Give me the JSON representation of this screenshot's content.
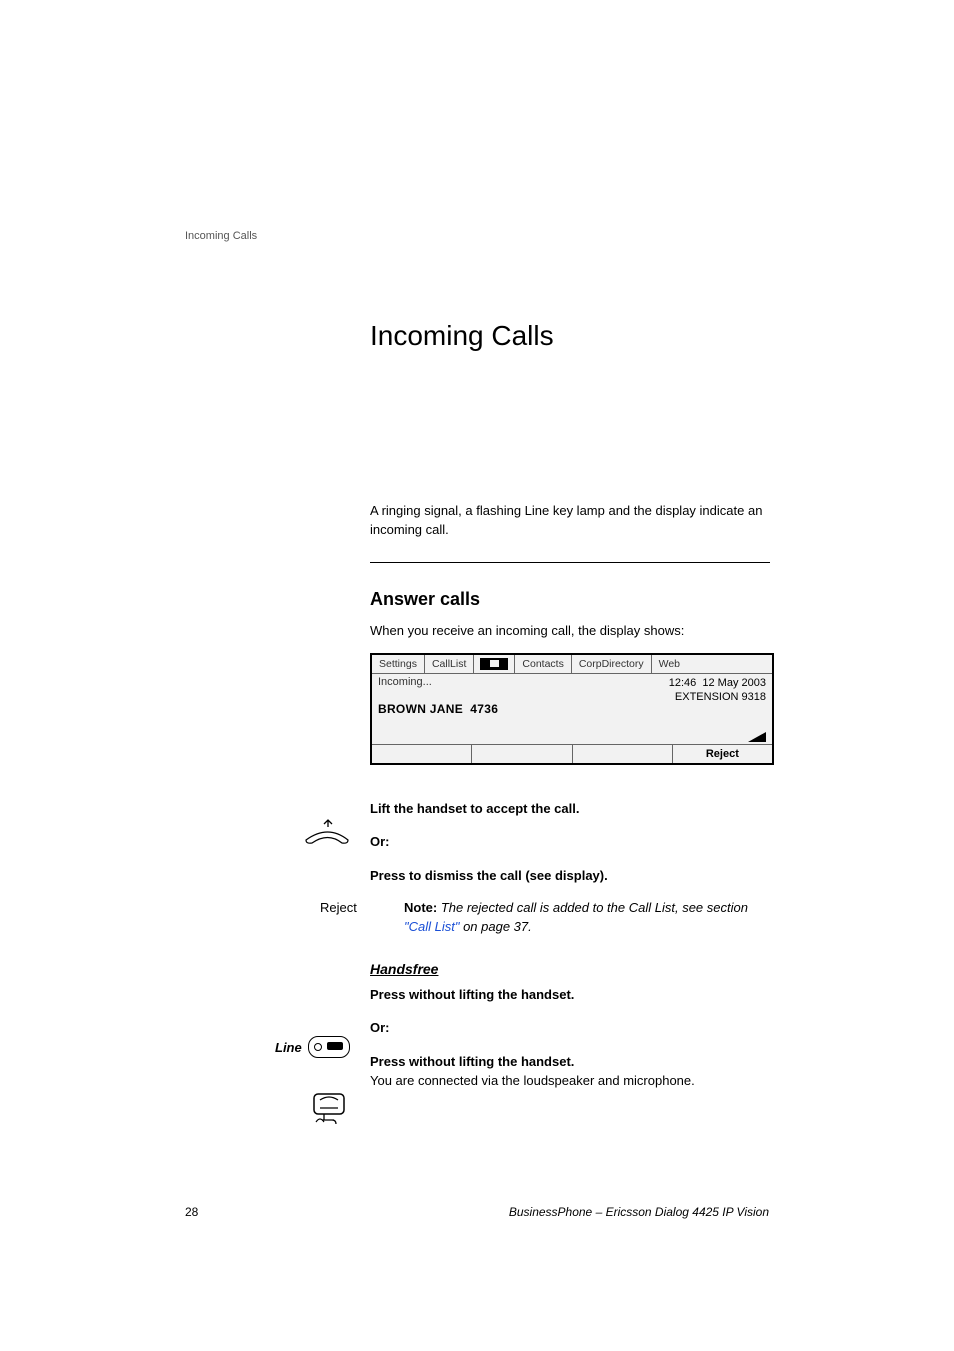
{
  "header_label": "Incoming Calls",
  "title": "Incoming Calls",
  "intro": "A ringing signal, a flashing Line key lamp and the display indicate an incoming call.",
  "section_heading": "Answer calls",
  "display_intro": "When you receive an incoming call, the display shows:",
  "display": {
    "menu": [
      "Settings",
      "CallList",
      "Contacts",
      "CorpDirectory",
      "Web"
    ],
    "status": "Incoming...",
    "time": "12:46",
    "date": "12 May 2003",
    "extension": "EXTENSION 9318",
    "caller_name": "BROWN JANE",
    "caller_number": "4736",
    "softkeys": [
      "",
      "",
      "",
      "Reject"
    ]
  },
  "instr": {
    "lift": "Lift the handset to accept the call.",
    "or": "Or:",
    "reject_label": "Reject",
    "reject_text": "Press to dismiss the call (see display).",
    "note_label": "Note:",
    "note_body": "The rejected call is added to the Call List, see section ",
    "note_link": "\"Call List\"",
    "note_tail": " on page 37.",
    "handsfree_heading": "Handsfree",
    "line_label": "Line",
    "press1": "Press without lifting the handset.",
    "press2": "Press without lifting the handset.",
    "press2_sub": "You are connected via the loudspeaker and microphone."
  },
  "footer": {
    "page": "28",
    "product": "BusinessPhone – Ericsson Dialog 4425 IP Vision"
  }
}
